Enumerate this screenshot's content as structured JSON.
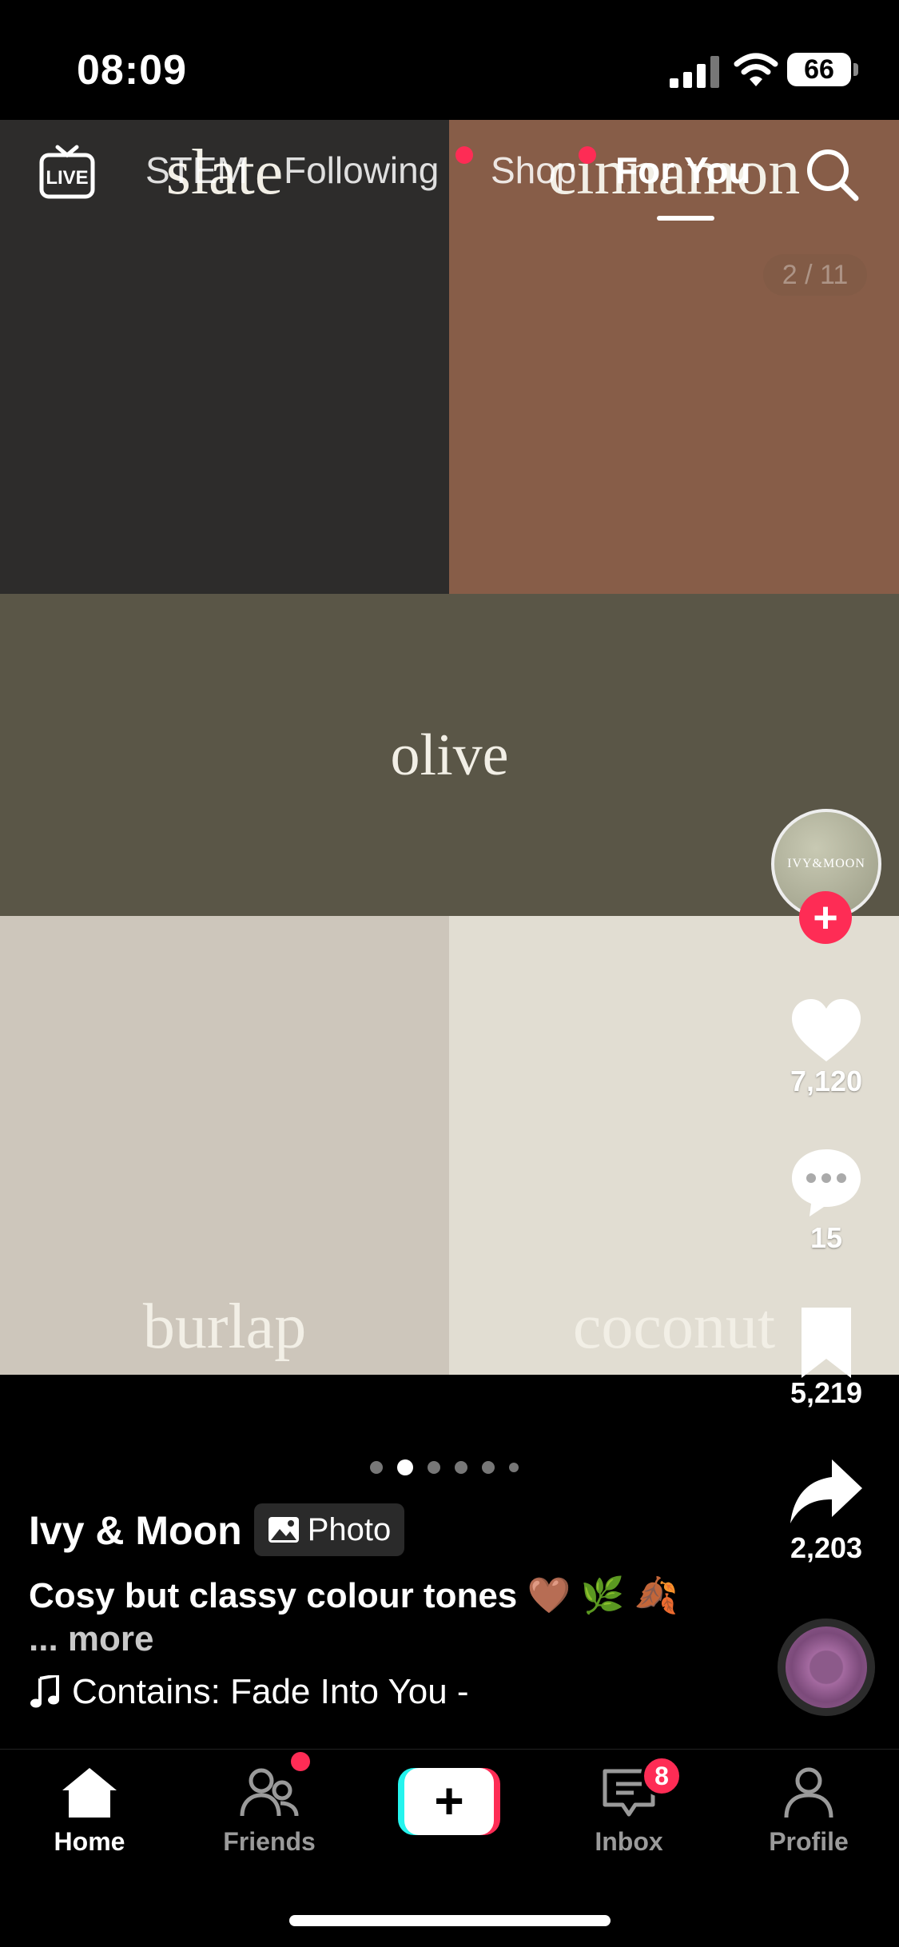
{
  "status_bar": {
    "time": "08:09",
    "battery": "66"
  },
  "photo": {
    "swatches": {
      "slate": "slate",
      "cinnamon": "cinnamon",
      "olive": "olive",
      "burlap": "burlap",
      "coconut": "coconut"
    },
    "counter": "2 / 11",
    "colors": {
      "slate": "#2d2c2b",
      "cinnamon": "#875d48",
      "olive": "#5a5647",
      "burlap": "#cdc6bb",
      "coconut": "#e1ddd2"
    }
  },
  "top_nav": {
    "live_label": "LIVE",
    "tabs": [
      {
        "label": "STEM",
        "active": false
      },
      {
        "label": "Following",
        "active": false,
        "dot": true
      },
      {
        "label": "Shop",
        "active": false,
        "dot": true
      },
      {
        "label": "For You",
        "active": true
      }
    ]
  },
  "creator": {
    "avatar_text": "IVY&MOON",
    "name": "Ivy & Moon",
    "post_type": "Photo"
  },
  "actions": {
    "likes": "7,120",
    "comments": "15",
    "saves": "5,219",
    "shares": "2,203"
  },
  "caption": {
    "text": "Cosy but classy colour tones 🤎 🌿 🍂",
    "more": "... more"
  },
  "music": {
    "text": "Contains: Fade Into You -"
  },
  "pager": {
    "count": 6,
    "active_index": 1
  },
  "tab_bar": {
    "items": [
      {
        "label": "Home",
        "active": true
      },
      {
        "label": "Friends",
        "active": false
      },
      {
        "label": "Inbox",
        "active": false
      },
      {
        "label": "Profile",
        "active": false
      }
    ],
    "inbox_badge": "8",
    "create_symbol": "+"
  },
  "colors": {
    "accent": "#fe2c55",
    "cyan": "#25f4ee",
    "background": "#000000"
  }
}
